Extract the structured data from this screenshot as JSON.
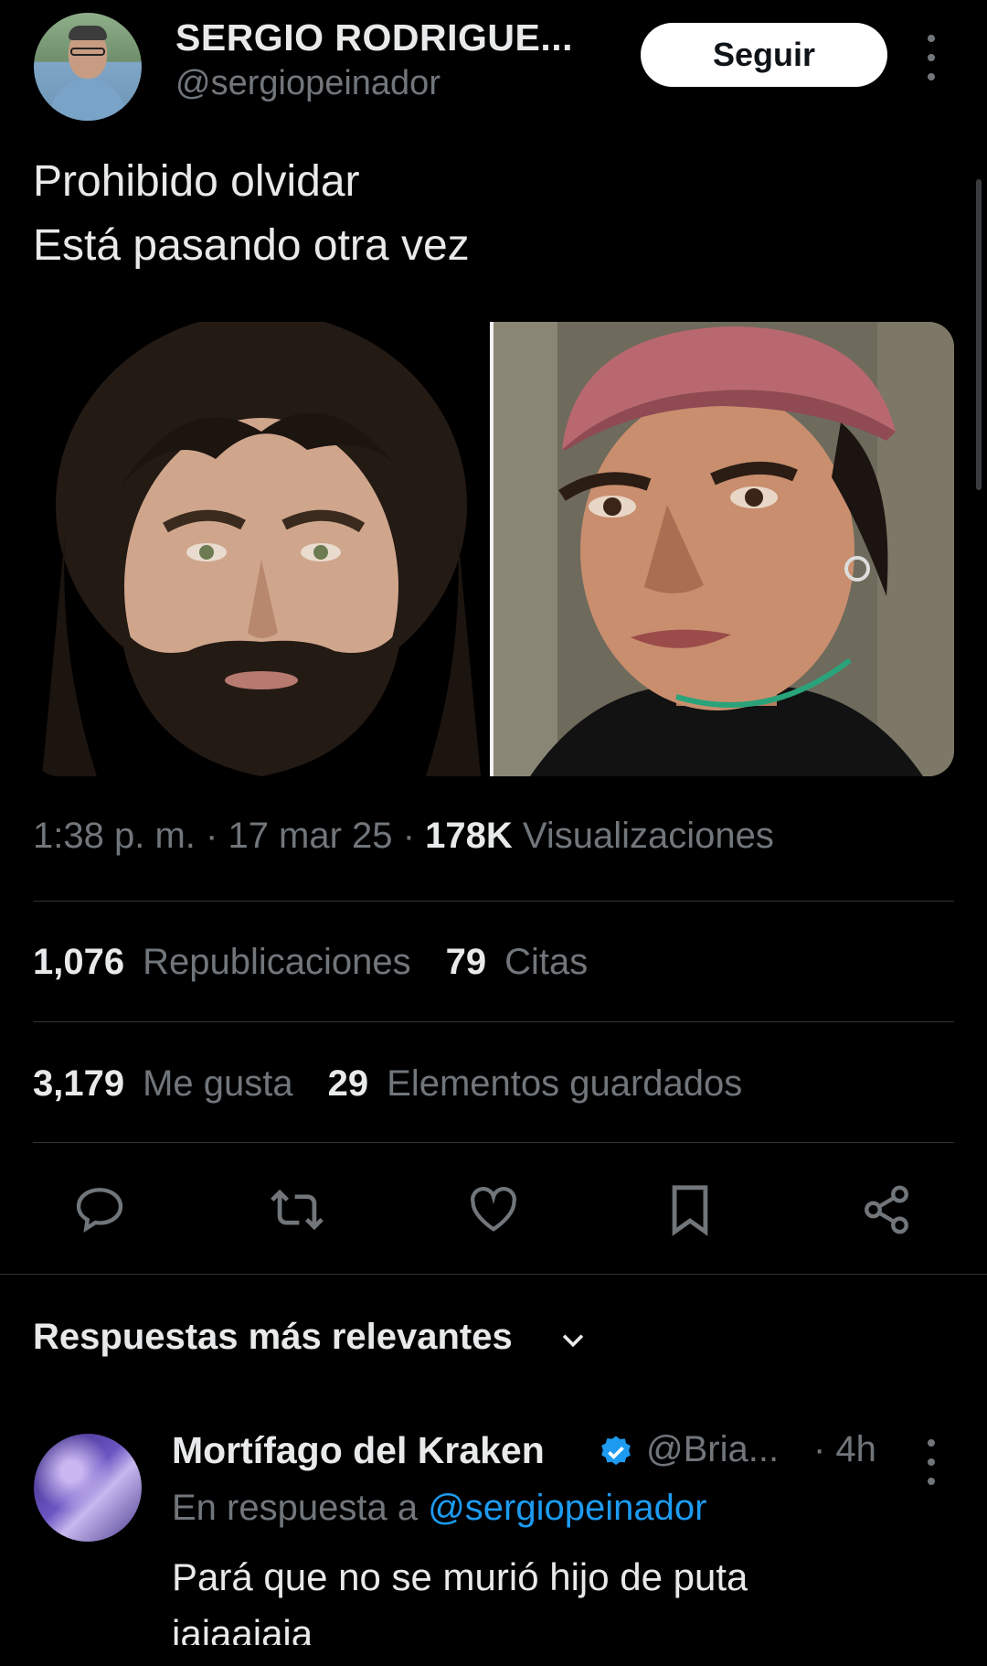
{
  "tweet": {
    "author_name": "SERGIO RODRIGUE...",
    "author_handle": "@sergiopeinador",
    "follow_label": "Seguir",
    "text": "Prohibido olvidar\nEstá pasando otra vez",
    "time": "1:38 p. m.",
    "date": "17 mar 25",
    "views_count": "178K",
    "views_label": "Visualizaciones",
    "separator": "·"
  },
  "stats": {
    "reposts_count": "1,076",
    "reposts_label": "Republicaciones",
    "quotes_count": "79",
    "quotes_label": "Citas",
    "likes_count": "3,179",
    "likes_label": "Me gusta",
    "bookmarks_count": "29",
    "bookmarks_label": "Elementos guardados"
  },
  "actions": [
    "reply-icon",
    "repost-icon",
    "like-icon",
    "bookmark-icon",
    "share-icon"
  ],
  "replies": {
    "sort_label": "Respuestas más relevantes",
    "items": [
      {
        "name": "Mortífago del Kraken",
        "handle": "@Bria...",
        "time": "· 4h",
        "reply_prefix": "En respuesta a",
        "reply_mention": "@sergiopeinador",
        "text": "Pará que no se murió hijo de puta\njajaajaja"
      }
    ]
  },
  "colors": {
    "background": "#000000",
    "text": "#e7e9ea",
    "secondary": "#71767b",
    "accent": "#1d9bf0",
    "divider": "#2f3336"
  }
}
